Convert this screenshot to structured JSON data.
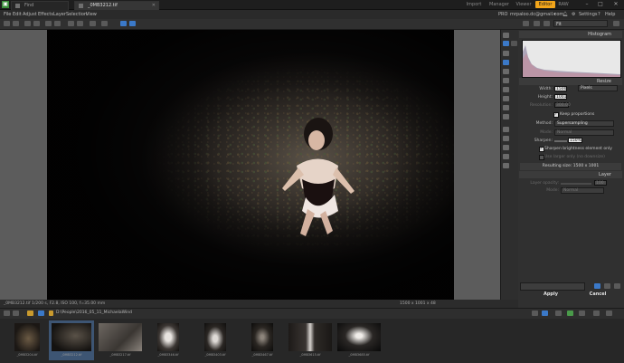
{
  "titlebar": {
    "tabs": [
      {
        "label": "Find"
      },
      {
        "label": "_0MB3212.tif"
      }
    ],
    "modes": [
      "Import",
      "Manager",
      "Viewer",
      "Editor",
      "RAW"
    ],
    "active_mode": "Editor",
    "window_buttons": [
      "–",
      "□",
      "✕"
    ]
  },
  "menubar": {
    "items": [
      "File",
      "Edit",
      "Adjust",
      "Effects",
      "Layer",
      "Selection",
      "View"
    ],
    "account_prefix": "PRO",
    "account": "mrpaloo.dc@gmail.com",
    "account_arrow": "▾",
    "settings": "Settings",
    "help": "Help"
  },
  "toolbar": {
    "zoom_value": "Fit"
  },
  "image": {
    "status_left": "_0MB3212.tif  1/200 s, F2.8, ISO 100, f=35.00 mm",
    "status_right": "1500 x 1001 x 48"
  },
  "panel": {
    "histogram_title": "Histogram",
    "resize_title": "Resize",
    "width_label": "Width:",
    "width_value": "1500",
    "height_label": "Height:",
    "height_value": "1001",
    "resolution_label": "Resolution:",
    "resolution_value": "300.00",
    "unit": "Pixels",
    "keep_proportions": "Keep proportions",
    "method_label": "Method:",
    "method_value": "Supersampling",
    "mode_label": "Mode:",
    "mode_value": "Normal",
    "sharpen_label": "Sharpen:",
    "sharpen_value": "150%",
    "sharpen_brightness": "Sharpen brightness element only",
    "use_larger": "Use larger only (no downsize)",
    "resulting_size": "Resulting size:  1500 x 1001",
    "layer_title": "Layer",
    "layer_opacity_label": "Layer opacity:",
    "layer_opacity_value": "100",
    "layer_mode_label": "Mode:",
    "layer_mode_value": "Normal",
    "apply": "Apply",
    "cancel": "Cancel"
  },
  "filmstrip": {
    "path": "D:\\People\\2016_05_11_MichaelaWind",
    "thumbnails": [
      {
        "caption": "_0MB3204.tif"
      },
      {
        "caption": "_0MB3212.tif"
      },
      {
        "caption": "_0MB3217.tif"
      },
      {
        "caption": "_0MB3346.tif"
      },
      {
        "caption": "_0MB3403.tif"
      },
      {
        "caption": "_0MB3467.tif"
      },
      {
        "caption": "_0MB3615.tif"
      },
      {
        "caption": "_0MB3685.tif"
      }
    ]
  },
  "colors": {
    "accent": "#f2a51a",
    "selection": "#3d5573",
    "tool_active": "#3b79c8"
  }
}
